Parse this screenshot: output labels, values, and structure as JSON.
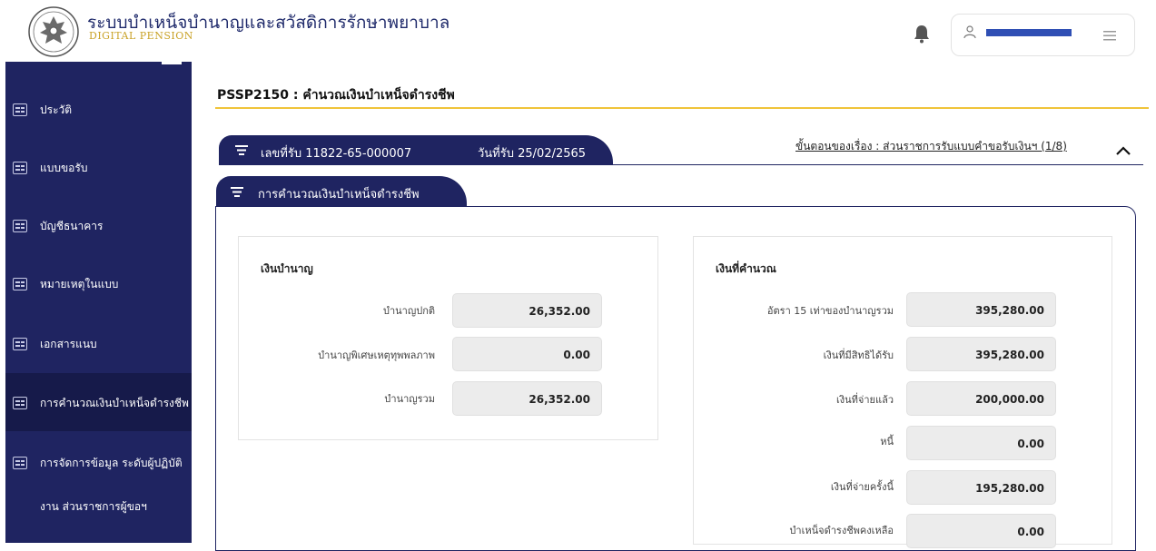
{
  "header": {
    "app_title": "ระบบบำเหน็จบำนาญและสวัสดิการรักษาพยาบาล",
    "app_subtitle": "DIGITAL PENSION"
  },
  "sidebar": {
    "items": [
      {
        "label": "ประวัติ",
        "icon": "document-icon"
      },
      {
        "label": "แบบขอรับ",
        "icon": "document-icon"
      },
      {
        "label": "บัญชีธนาคาร",
        "icon": "document-icon"
      },
      {
        "label": "หมายเหตุในแบบ",
        "icon": "document-icon"
      },
      {
        "label": "เอกสารแนบ",
        "icon": "document-icon"
      },
      {
        "label": "การคำนวณเงินบำเหน็จดำรงชีพ",
        "icon": "document-icon",
        "active": true
      },
      {
        "label": "การจัดการข้อมูล ระดับผู้ปฏิบัติ",
        "label2": "งาน ส่วนราชการผู้ขอฯ",
        "icon": "document-icon"
      }
    ]
  },
  "page": {
    "title": "PSSP2150 : คำนวณเงินบำเหน็จดำรงชีพ"
  },
  "case": {
    "number_text": "เลขที่รับ 11822-65-000007",
    "date_text": "วันที่รับ 25/02/2565",
    "steps_link": "ขั้นตอนของเรื่อง : ส่วนราชการรับแบบคำขอรับเงินฯ (1/8)"
  },
  "calc_tab": {
    "label": "การคำนวณเงินบำเหน็จดำรงชีพ"
  },
  "pension_panel": {
    "title": "เงินบำนาญ",
    "rows": [
      {
        "label": "บำนาญปกติ",
        "value": "26,352.00"
      },
      {
        "label": "บำนาญพิเศษเหตุทุพพลภาพ",
        "value": "0.00"
      },
      {
        "label": "บำนาญรวม",
        "value": "26,352.00"
      }
    ]
  },
  "calc_panel": {
    "title": "เงินที่คำนวณ",
    "rows": [
      {
        "label": "อัตรา 15 เท่าของบำนาญรวม",
        "value": "395,280.00"
      },
      {
        "label": "เงินที่มีสิทธิได้รับ",
        "value": "395,280.00"
      },
      {
        "label": "เงินที่จ่ายแล้ว",
        "value": "200,000.00"
      },
      {
        "label": "หนี้",
        "value": "0.00"
      },
      {
        "label": "เงินที่จ่ายครั้งนี้",
        "value": "195,280.00"
      },
      {
        "label": "บำเหน็จดำรงชีพคงเหลือ",
        "value": "0.00"
      }
    ]
  },
  "colors": {
    "navy": "#1f2461",
    "accent_yellow": "#f0c43a",
    "user_bar": "#2f4fb4"
  }
}
